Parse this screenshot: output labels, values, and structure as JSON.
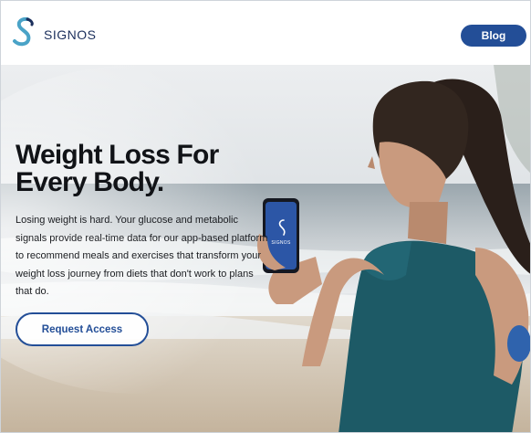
{
  "header": {
    "logo_text": "SIGNOS",
    "blog_label": "Blog"
  },
  "hero": {
    "headline": "Weight Loss For Every Body.",
    "body": "Losing weight is hard. Your glucose and metabolic signals provide real-time data for our app-based platform to recommend meals and exercises that transform your weight loss journey from diets that don't work to plans that do.",
    "cta_label": "Request Access",
    "phone_logo_text": "SIGNOS"
  },
  "colors": {
    "brand": "#234e97",
    "logo_teal": "#4aa3c7",
    "headline": "#111317"
  },
  "icons": {
    "logo": "signos-s-logo-icon",
    "phone": "smartphone-icon",
    "sensor": "glucose-sensor-icon"
  }
}
